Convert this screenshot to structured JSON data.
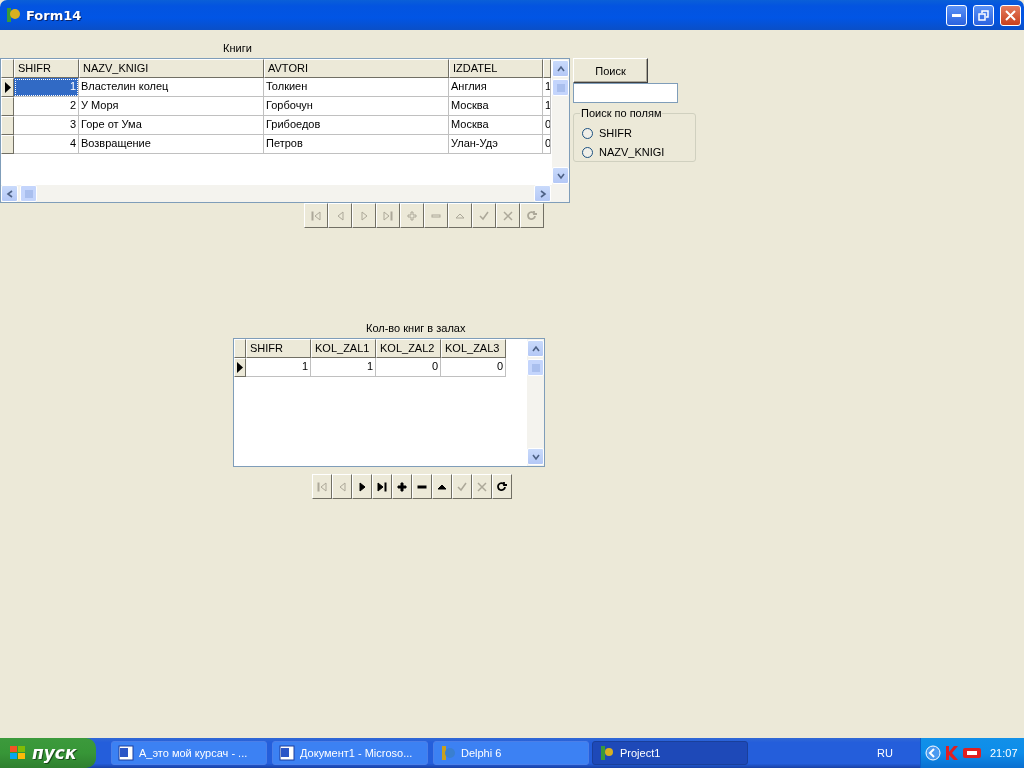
{
  "window": {
    "title": "Form14"
  },
  "books_label": "Книги",
  "books_grid": {
    "columns": [
      "SHIFR",
      "NAZV_KNIGI",
      "AVTORI",
      "IZDATEL"
    ],
    "rows": [
      {
        "selected": true,
        "cells": [
          "1",
          "Властелин колец",
          "Толкиен",
          "Англия"
        ],
        "column_5": "1"
      },
      {
        "selected": false,
        "cells": [
          "2",
          "У Моря",
          "Горбочун",
          "Москва"
        ],
        "column_5": "1"
      },
      {
        "selected": false,
        "cells": [
          "3",
          "Горе от Ума",
          "Грибоедов",
          "Москва"
        ],
        "column_5": "0"
      },
      {
        "selected": false,
        "cells": [
          "4",
          "Возвращение",
          "Петров",
          "Улан-Удэ"
        ],
        "column_5": "0"
      }
    ]
  },
  "books_navigator": [
    {
      "kind": "first",
      "disabled": true
    },
    {
      "kind": "prior",
      "disabled": true
    },
    {
      "kind": "next",
      "disabled": true
    },
    {
      "kind": "last",
      "disabled": true
    },
    {
      "kind": "insert",
      "disabled": true
    },
    {
      "kind": "delete",
      "disabled": true
    },
    {
      "kind": "edit",
      "disabled": true
    },
    {
      "kind": "post",
      "disabled": true
    },
    {
      "kind": "cancel",
      "disabled": true
    },
    {
      "kind": "refresh",
      "disabled": true
    }
  ],
  "search": {
    "button": "Поиск",
    "group_title": "Поиск по полям",
    "options": [
      {
        "label": "SHIFR",
        "selected": false
      },
      {
        "label": "NAZV_KNIGI",
        "selected": false
      }
    ]
  },
  "halls_label": "Кол-во книг в залах",
  "halls_grid": {
    "columns": [
      "SHIFR",
      "KOL_ZAL1",
      "KOL_ZAL2",
      "KOL_ZAL3"
    ],
    "rows": [
      {
        "selected": true,
        "cells": [
          "1",
          "1",
          "0",
          "0"
        ]
      }
    ]
  },
  "halls_navigator": [
    {
      "kind": "first",
      "disabled": true
    },
    {
      "kind": "prior",
      "disabled": true
    },
    {
      "kind": "next",
      "disabled": false
    },
    {
      "kind": "last",
      "disabled": false
    },
    {
      "kind": "insert",
      "disabled": false
    },
    {
      "kind": "delete",
      "disabled": false
    },
    {
      "kind": "edit",
      "disabled": false
    },
    {
      "kind": "post",
      "disabled": true
    },
    {
      "kind": "cancel",
      "disabled": true
    },
    {
      "kind": "refresh",
      "disabled": false
    }
  ],
  "taskbar": {
    "start": "пуск",
    "tasks": [
      {
        "label": "А_это мой курсач - ...",
        "kind": "word",
        "selected": false
      },
      {
        "label": "Документ1 - Microso...",
        "kind": "word",
        "selected": false
      },
      {
        "label": "Delphi 6",
        "kind": "delphi",
        "selected": false
      },
      {
        "label": "Project1",
        "kind": "app",
        "selected": true
      }
    ],
    "language": "RU",
    "clock": "21:07"
  }
}
